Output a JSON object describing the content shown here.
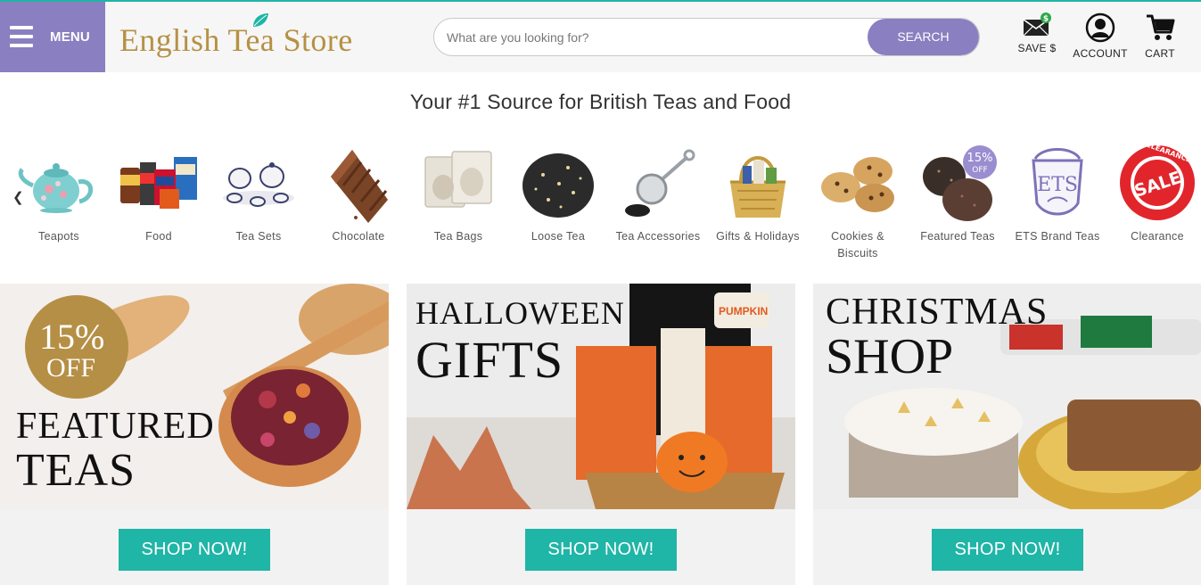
{
  "header": {
    "menu_label": "MENU",
    "logo_text": "English Tea Store",
    "search_placeholder": "What are you looking for?",
    "search_button": "SEARCH",
    "save_label": "SAVE $",
    "account_label": "ACCOUNT",
    "cart_label": "CART"
  },
  "tagline": "Your #1 Source for British Teas and Food",
  "categories": [
    {
      "label": "Teapots"
    },
    {
      "label": "Food"
    },
    {
      "label": "Tea Sets"
    },
    {
      "label": "Chocolate"
    },
    {
      "label": "Tea Bags"
    },
    {
      "label": "Loose Tea"
    },
    {
      "label": "Tea Accessories"
    },
    {
      "label": "Gifts & Holidays"
    },
    {
      "label": "Cookies & Biscuits"
    },
    {
      "label": "Featured Teas",
      "badge_pct": "15%",
      "badge_off": "OFF"
    },
    {
      "label": "ETS Brand Teas",
      "emblem": "ETS"
    },
    {
      "label": "Clearance",
      "sale": "SALE",
      "ring": "CLEARANCE"
    }
  ],
  "promos": [
    {
      "badge_pct": "15%",
      "badge_off": "OFF",
      "line1": "FEATURED",
      "line2": "TEAS",
      "button": "SHOP NOW!"
    },
    {
      "line1": "HALLOWEEN",
      "line2": "GIFTS",
      "bag_label": "PUMPKIN",
      "button": "SHOP NOW!"
    },
    {
      "line1": "CHRISTMAS",
      "line2": "SHOP",
      "button": "SHOP NOW!"
    }
  ],
  "colors": {
    "accent_purple": "#8a7fc0",
    "accent_teal": "#1fb5a7",
    "logo_gold": "#b69144"
  }
}
